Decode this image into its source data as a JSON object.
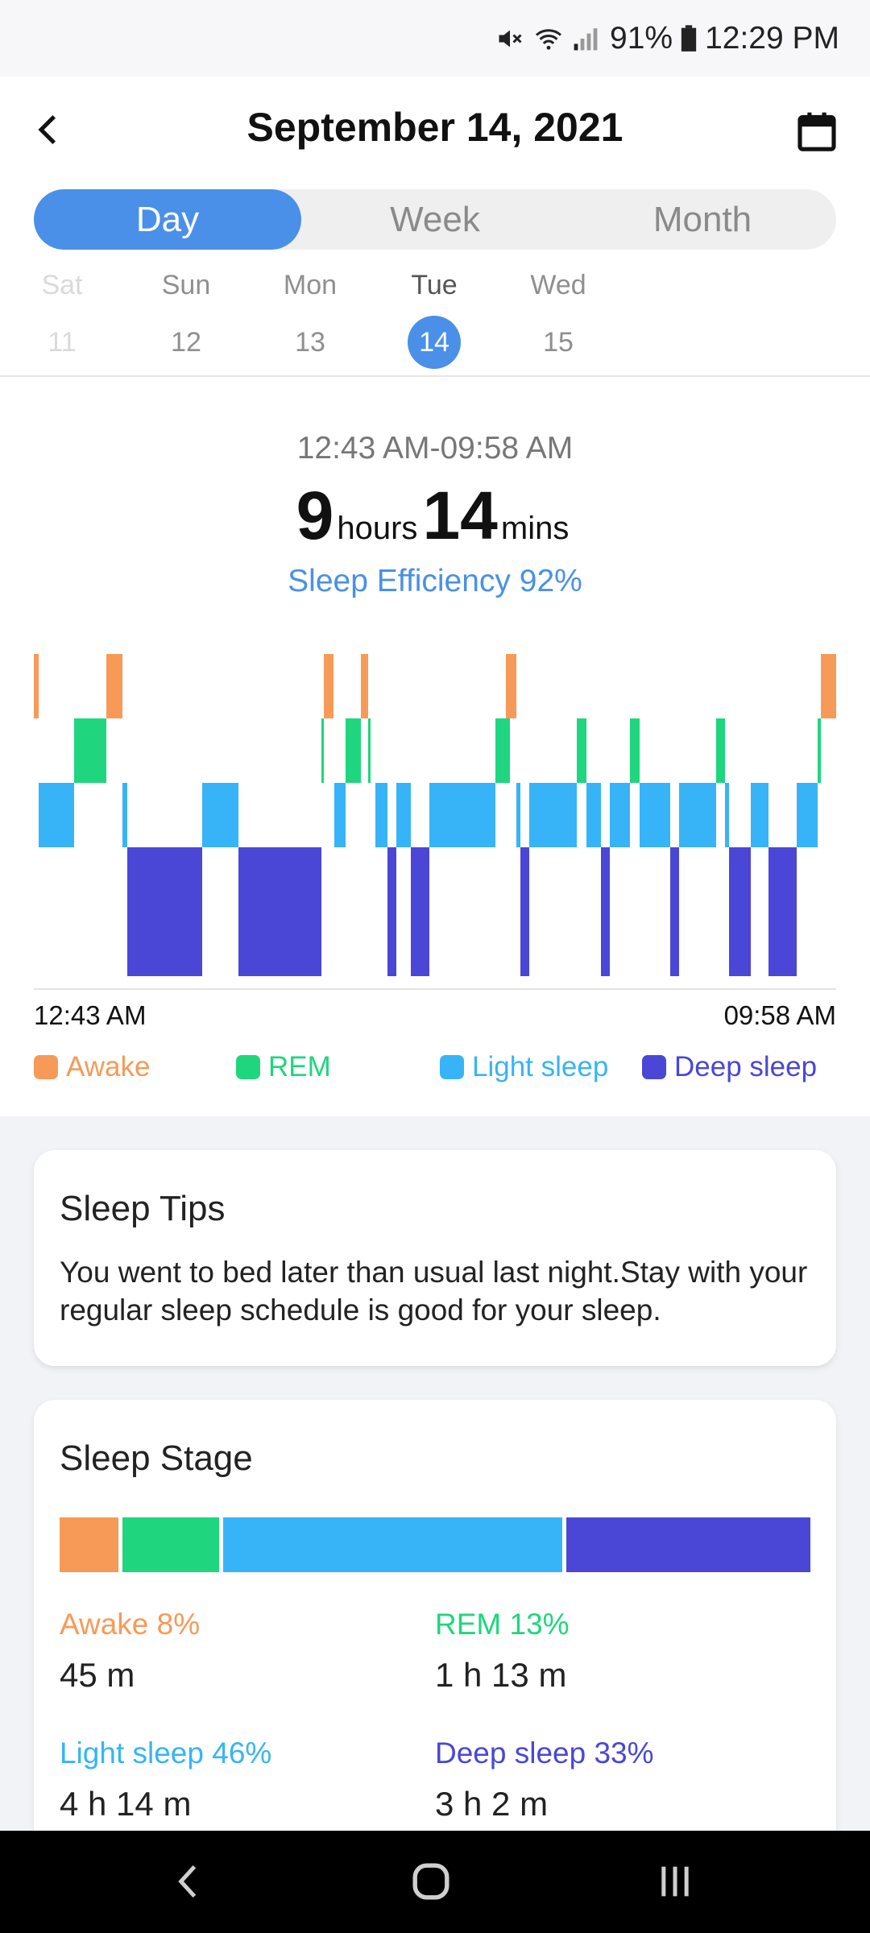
{
  "status_bar": {
    "battery": "91%",
    "time": "12:29 PM"
  },
  "header": {
    "title": "September 14, 2021"
  },
  "tabs": [
    {
      "label": "Day",
      "active": true
    },
    {
      "label": "Week",
      "active": false
    },
    {
      "label": "Month",
      "active": false
    }
  ],
  "days": [
    {
      "name": "Sat",
      "num": "11"
    },
    {
      "name": "Sun",
      "num": "12"
    },
    {
      "name": "Mon",
      "num": "13"
    },
    {
      "name": "Tue",
      "num": "14"
    },
    {
      "name": "Wed",
      "num": "15"
    }
  ],
  "summary": {
    "range": "12:43 AM-09:58 AM",
    "hours": "9",
    "hours_unit": "hours",
    "mins": "14",
    "mins_unit": "mins",
    "efficiency": "Sleep Efficiency 92%"
  },
  "chart_data": {
    "type": "hypnogram",
    "x_start": "12:43 AM",
    "x_end": "09:58 AM",
    "stages": [
      "Awake",
      "REM",
      "Light sleep",
      "Deep sleep"
    ],
    "colors": {
      "Awake": "#f79a58",
      "REM": "#1fd67e",
      "Light sleep": "#37b4f7",
      "Deep sleep": "#4b47d6"
    },
    "segments": [
      {
        "stage": "Awake",
        "start": 0.0,
        "end": 0.006
      },
      {
        "stage": "Light sleep",
        "start": 0.006,
        "end": 0.05
      },
      {
        "stage": "REM",
        "start": 0.05,
        "end": 0.09
      },
      {
        "stage": "Awake",
        "start": 0.09,
        "end": 0.11
      },
      {
        "stage": "Light sleep",
        "start": 0.11,
        "end": 0.116
      },
      {
        "stage": "Deep sleep",
        "start": 0.116,
        "end": 0.21
      },
      {
        "stage": "Light sleep",
        "start": 0.21,
        "end": 0.255
      },
      {
        "stage": "Deep sleep",
        "start": 0.255,
        "end": 0.358
      },
      {
        "stage": "REM",
        "start": 0.358,
        "end": 0.361
      },
      {
        "stage": "Awake",
        "start": 0.361,
        "end": 0.374
      },
      {
        "stage": "Light sleep",
        "start": 0.374,
        "end": 0.389
      },
      {
        "stage": "REM",
        "start": 0.389,
        "end": 0.408
      },
      {
        "stage": "Awake",
        "start": 0.408,
        "end": 0.417
      },
      {
        "stage": "REM",
        "start": 0.417,
        "end": 0.42
      },
      {
        "stage": "Light sleep",
        "start": 0.426,
        "end": 0.441
      },
      {
        "stage": "Deep sleep",
        "start": 0.441,
        "end": 0.452
      },
      {
        "stage": "Light sleep",
        "start": 0.452,
        "end": 0.47
      },
      {
        "stage": "Deep sleep",
        "start": 0.47,
        "end": 0.493
      },
      {
        "stage": "Light sleep",
        "start": 0.493,
        "end": 0.575
      },
      {
        "stage": "REM",
        "start": 0.575,
        "end": 0.593
      },
      {
        "stage": "Awake",
        "start": 0.588,
        "end": 0.601
      },
      {
        "stage": "Light sleep",
        "start": 0.601,
        "end": 0.606
      },
      {
        "stage": "Deep sleep",
        "start": 0.606,
        "end": 0.617
      },
      {
        "stage": "Light sleep",
        "start": 0.617,
        "end": 0.677
      },
      {
        "stage": "REM",
        "start": 0.677,
        "end": 0.689
      },
      {
        "stage": "Light sleep",
        "start": 0.689,
        "end": 0.707
      },
      {
        "stage": "Deep sleep",
        "start": 0.707,
        "end": 0.718
      },
      {
        "stage": "Light sleep",
        "start": 0.718,
        "end": 0.743
      },
      {
        "stage": "REM",
        "start": 0.743,
        "end": 0.755
      },
      {
        "stage": "Light sleep",
        "start": 0.755,
        "end": 0.793
      },
      {
        "stage": "Deep sleep",
        "start": 0.793,
        "end": 0.804
      },
      {
        "stage": "Light sleep",
        "start": 0.804,
        "end": 0.85
      },
      {
        "stage": "REM",
        "start": 0.85,
        "end": 0.861
      },
      {
        "stage": "Light sleep",
        "start": 0.861,
        "end": 0.866
      },
      {
        "stage": "Deep sleep",
        "start": 0.866,
        "end": 0.894
      },
      {
        "stage": "Light sleep",
        "start": 0.894,
        "end": 0.916
      },
      {
        "stage": "Deep sleep",
        "start": 0.916,
        "end": 0.951
      },
      {
        "stage": "Light sleep",
        "start": 0.951,
        "end": 0.977
      },
      {
        "stage": "REM",
        "start": 0.977,
        "end": 0.981
      },
      {
        "stage": "Awake",
        "start": 0.981,
        "end": 1.0
      }
    ]
  },
  "legend": [
    {
      "label": "Awake",
      "color": "#f79a58"
    },
    {
      "label": "REM",
      "color": "#1fd67e"
    },
    {
      "label": "Light sleep",
      "color": "#37b4f7"
    },
    {
      "label": "Deep sleep",
      "color": "#4b47d6"
    }
  ],
  "tips": {
    "title": "Sleep Tips",
    "text": "You went to bed later than usual last night.Stay with your regular sleep schedule is good for your sleep."
  },
  "stage_card": {
    "title": "Sleep Stage",
    "stages": [
      {
        "label": "Awake 8%",
        "value": "45 m",
        "percent": 8,
        "color": "#f79a58"
      },
      {
        "label": "REM 13%",
        "value": "1 h 13 m",
        "percent": 13,
        "color": "#1fd67e"
      },
      {
        "label": "Light sleep 46%",
        "value": "4 h 14 m",
        "percent": 46,
        "color": "#37b4f7"
      },
      {
        "label": "Deep sleep 33%",
        "value": "3 h 2 m",
        "percent": 33,
        "color": "#4b47d6"
      }
    ]
  }
}
